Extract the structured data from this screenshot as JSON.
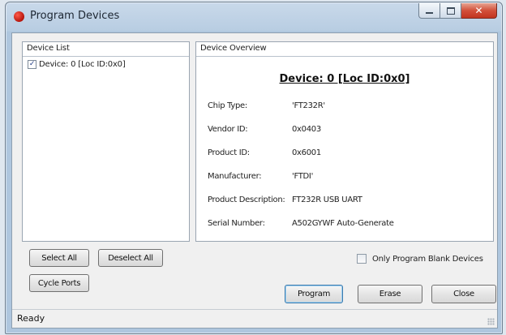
{
  "window": {
    "title": "Program Devices",
    "close_glyph": "✕"
  },
  "device_list": {
    "header": "Device List",
    "items": [
      {
        "label": "Device: 0 [Loc ID:0x0]",
        "checked": true,
        "check_glyph": "✓"
      }
    ]
  },
  "device_overview": {
    "header": "Device Overview",
    "title": "Device: 0 [Loc ID:0x0]",
    "fields": [
      {
        "label": "Chip Type:",
        "value": "'FT232R'"
      },
      {
        "label": "Vendor ID:",
        "value": "0x0403"
      },
      {
        "label": "Product ID:",
        "value": "0x6001"
      },
      {
        "label": "Manufacturer:",
        "value": "'FTDI'"
      },
      {
        "label": "Product Description:",
        "value": "FT232R USB UART"
      },
      {
        "label": "Serial Number:",
        "value": "A502GYWF Auto-Generate"
      }
    ]
  },
  "buttons": {
    "select_all": "Select All",
    "deselect_all": "Deselect All",
    "cycle_ports": "Cycle Ports",
    "program": "Program",
    "erase": "Erase",
    "close": "Close"
  },
  "options": {
    "only_program_blank": "Only Program Blank Devices",
    "only_program_blank_checked": false
  },
  "status": {
    "text": "Ready"
  },
  "colors": {
    "accent": "#3d7bad",
    "close_button": "#c2341f"
  }
}
